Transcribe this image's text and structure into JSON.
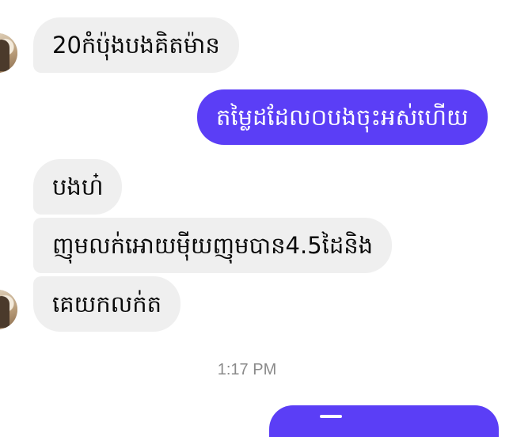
{
  "messages": [
    {
      "text": "20កំប៉ុងបងគិតម៉ាន"
    },
    {
      "text": "តម្លៃដដែល០បងចុះអស់ហើយ"
    },
    {
      "text": "បងហ៎"
    },
    {
      "text": "ញុមលក់អោយម៉ីយញុមបាន4.5ដៃនិង"
    },
    {
      "text": "គេយកលក់ត"
    }
  ],
  "timestamp": "1:17 PM",
  "colors": {
    "outgoing": "#5b3ef6",
    "incoming": "#efefef",
    "timestamp": "#8a8a8a"
  }
}
